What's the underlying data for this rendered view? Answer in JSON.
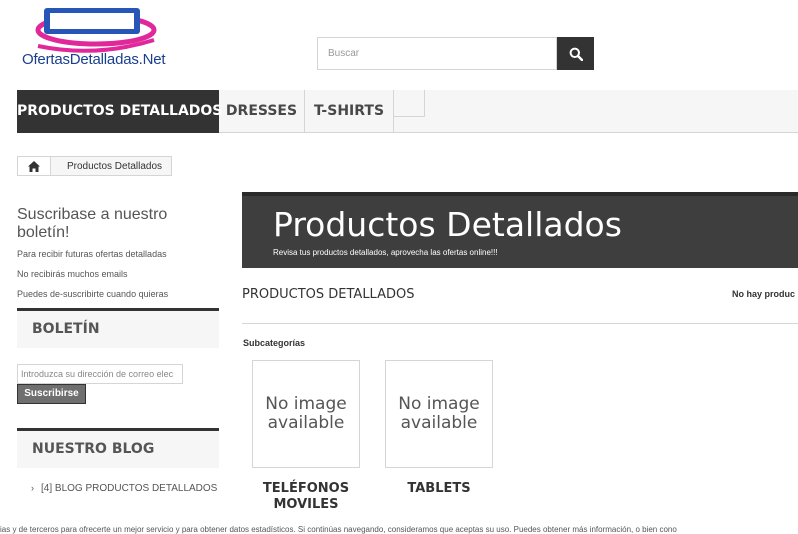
{
  "logo": {
    "text": "OfertasDetalladas.Net"
  },
  "search": {
    "placeholder": "Buscar",
    "button_icon": "search-icon"
  },
  "menu": {
    "items": [
      {
        "label": "PRODUCTOS DETALLADOS",
        "active": true
      },
      {
        "label": "DRESSES"
      },
      {
        "label": "T-SHIRTS"
      }
    ]
  },
  "breadcrumb": {
    "home_icon": "home-icon",
    "current": "Productos Detallados"
  },
  "newsletter": {
    "title": "Suscribase a nuestro boletín!",
    "lines": [
      "Para recibir futuras ofertas detalladas",
      "No recibirás muchos emails",
      "Puedes de-suscribirte cuando quieras"
    ],
    "block_title": "BOLETÍN",
    "email_placeholder": "Introduzca su dirección de correo elec",
    "subscribe_label": "Suscribirse"
  },
  "blog": {
    "block_title": "NUESTRO BLOG",
    "link": "[4] BLOG PRODUCTOS DETALLADOS"
  },
  "category": {
    "title": "Productos Detallados",
    "description": "Revisa tus productos detallados, aprovecha las ofertas online!!!",
    "heading": "PRODUCTOS DETALLADOS",
    "count_text": "No hay produc",
    "subcategories_label": "Subcategorías",
    "subcategories": [
      {
        "image_text": "No image available",
        "name": "TELÉFONOS MOVILES"
      },
      {
        "image_text": "No image available",
        "name": "TABLETS"
      }
    ]
  },
  "cookie_notice": "ias y de terceros para ofrecerte un mejor servicio y para obtener datos estadísticos. Si continúas navegando, consideramos que aceptas su uso. Puedes obtener más información, o bien cono",
  "colors": {
    "dark": "#333333",
    "banner": "#3e3e3e",
    "logo_blue": "#1a3f8f",
    "logo_magenta": "#e0289a"
  }
}
